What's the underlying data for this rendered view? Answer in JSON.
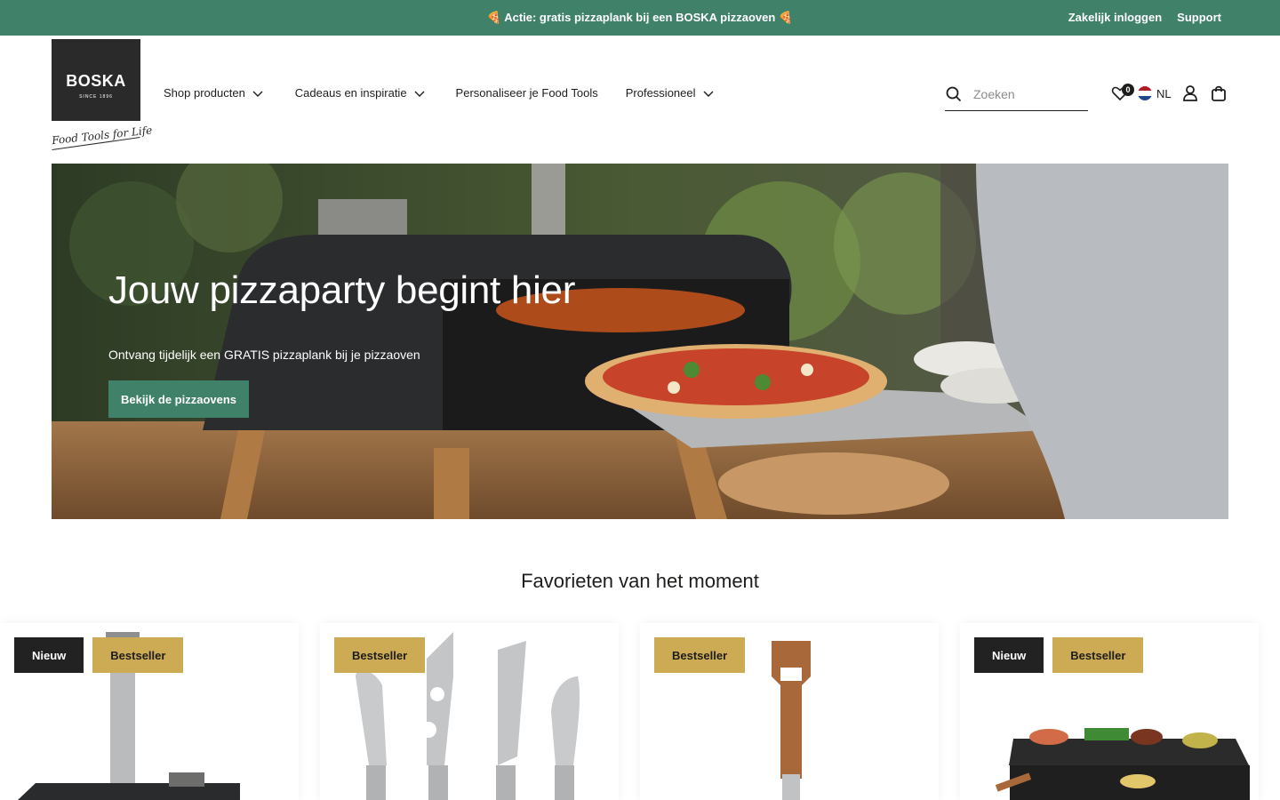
{
  "topbar": {
    "promo": "🍕 Actie: gratis pizzaplank bij een BOSKA pizzaoven 🍕",
    "links": [
      "Zakelijk inloggen",
      "Support"
    ]
  },
  "logo": {
    "brand": "BOSKA",
    "since": "SINCE 1896",
    "tagline": "Food Tools for Life"
  },
  "nav": {
    "items": [
      {
        "label": "Shop producten",
        "dropdown": true
      },
      {
        "label": "Cadeaus en inspiratie",
        "dropdown": true
      },
      {
        "label": "Personaliseer je Food Tools",
        "dropdown": false
      },
      {
        "label": "Professioneel",
        "dropdown": true
      }
    ]
  },
  "search": {
    "placeholder": "Zoeken",
    "icon": "search-icon"
  },
  "header_icons": {
    "wishlist_count": "0",
    "language": "NL",
    "icons": [
      "heart-icon",
      "flag-nl-icon",
      "user-icon",
      "bag-icon"
    ]
  },
  "hero": {
    "title": "Jouw pizzaparty begint hier",
    "subtitle": "Ontvang tijdelijk een GRATIS pizzaplank bij je pizzaoven",
    "cta": "Bekijk de pizzaovens"
  },
  "favorites": {
    "title": "Favorieten van het moment",
    "products": [
      {
        "badges": [
          "Nieuw",
          "Bestseller"
        ],
        "image": "pizza-oven"
      },
      {
        "badges": [
          "Bestseller"
        ],
        "image": "cheese-knives"
      },
      {
        "badges": [
          "Bestseller"
        ],
        "image": "cheese-fork"
      },
      {
        "badges": [
          "Nieuw",
          "Bestseller"
        ],
        "image": "raclette-grill"
      }
    ]
  },
  "colors": {
    "brand_green": "#40816a",
    "badge_gold": "#cdab55",
    "badge_dark": "#222222",
    "text": "#1d1d1b"
  }
}
